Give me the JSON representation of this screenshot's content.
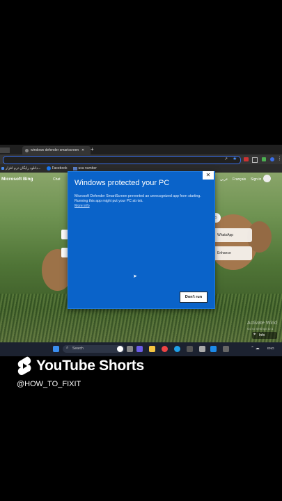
{
  "browser": {
    "tabs": [
      {
        "label": "windows defender smartscreen r"
      }
    ],
    "new_tab": "+",
    "bookmarks": [
      {
        "label": "دانلود رایگان ترم افزار..."
      },
      {
        "label": "Facebook"
      },
      {
        "label": "usa number"
      }
    ]
  },
  "bing": {
    "logo": "Microsoft Bing",
    "nav_chat": "Chat",
    "lang_ar": "عربي",
    "lang_fr": "Français",
    "sign_in": "Sign in",
    "tile_whatsapp": "WhatsApp",
    "tile_enhance": "Enhance",
    "watermark": "Activate Wind",
    "watermark_sub": "Go to Settings to a",
    "info": "Info"
  },
  "dialog": {
    "title": "Windows protected your PC",
    "message": "Microsoft Defender SmartScreen prevented an unrecognized app from starting. Running this app might put your PC at risk.",
    "more_info": "More info",
    "close": "✕",
    "dont_run": "Don't run"
  },
  "taskbar": {
    "search": "Search",
    "lang": "ENG"
  },
  "shorts": {
    "label": "YouTube Shorts",
    "handle": "@HOW_TO_FIXIT"
  }
}
